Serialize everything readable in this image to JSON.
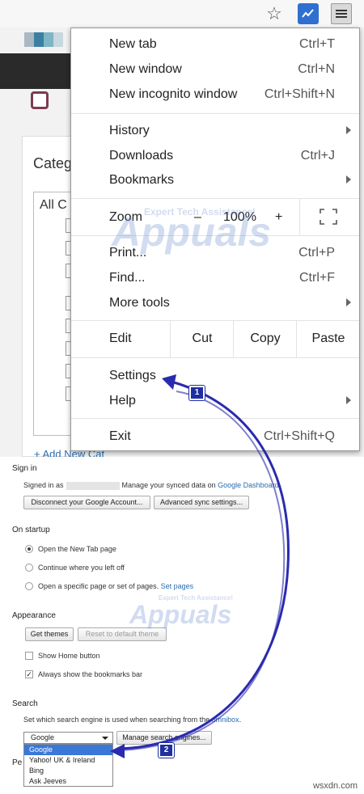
{
  "browser": {
    "star_icon": "star-outline-icon",
    "extension_icon": "chart-trend-icon",
    "menu_icon": "hamburger-menu-icon"
  },
  "background_page": {
    "category_label": "Categ",
    "all_label": "All C",
    "add_new_label": "+ Add New Cat"
  },
  "chrome_menu": {
    "new_tab": "New tab",
    "new_tab_key": "Ctrl+T",
    "new_window": "New window",
    "new_window_key": "Ctrl+N",
    "new_incognito": "New incognito window",
    "new_incognito_key": "Ctrl+Shift+N",
    "history": "History",
    "downloads": "Downloads",
    "downloads_key": "Ctrl+J",
    "bookmarks": "Bookmarks",
    "zoom": "Zoom",
    "zoom_minus": "–",
    "zoom_value": "100%",
    "zoom_plus": "+",
    "print": "Print...",
    "print_key": "Ctrl+P",
    "find": "Find...",
    "find_key": "Ctrl+F",
    "more_tools": "More tools",
    "edit": "Edit",
    "cut": "Cut",
    "copy": "Copy",
    "paste": "Paste",
    "settings": "Settings",
    "help": "Help",
    "exit": "Exit",
    "exit_key": "Ctrl+Shift+Q"
  },
  "watermark": {
    "line1": "Expert Tech Assistance!",
    "line2": "Appuals"
  },
  "settings": {
    "sign_in": {
      "title": "Sign in",
      "signed_in_as": "Signed in as",
      "manage_text": "Manage your synced data on",
      "dashboard_link": "Google Dashboard",
      "disconnect_button": "Disconnect your Google Account...",
      "advanced_sync_button": "Advanced sync settings..."
    },
    "on_startup": {
      "title": "On startup",
      "option1": "Open the New Tab page",
      "option2": "Continue where you left off",
      "option3": "Open a specific page or set of pages.",
      "set_pages_link": "Set pages"
    },
    "appearance": {
      "title": "Appearance",
      "get_themes": "Get themes",
      "reset_theme": "Reset to default theme",
      "show_home": "Show Home button",
      "show_bookmarks": "Always show the bookmarks bar"
    },
    "search": {
      "title": "Search",
      "description": "Set which search engine is used when searching from the",
      "omnibox_link": "omnibox",
      "selected_engine": "Google",
      "manage_button": "Manage search engines...",
      "options": [
        "Google",
        "Yahoo! UK & Ireland",
        "Bing",
        "Ask Jeeves"
      ]
    },
    "people_title": "Pe"
  },
  "annotations": {
    "badge1": "1",
    "badge2": "2",
    "arrow_color": "#2a2ab0"
  },
  "site_watermark": "wsxdn.com"
}
